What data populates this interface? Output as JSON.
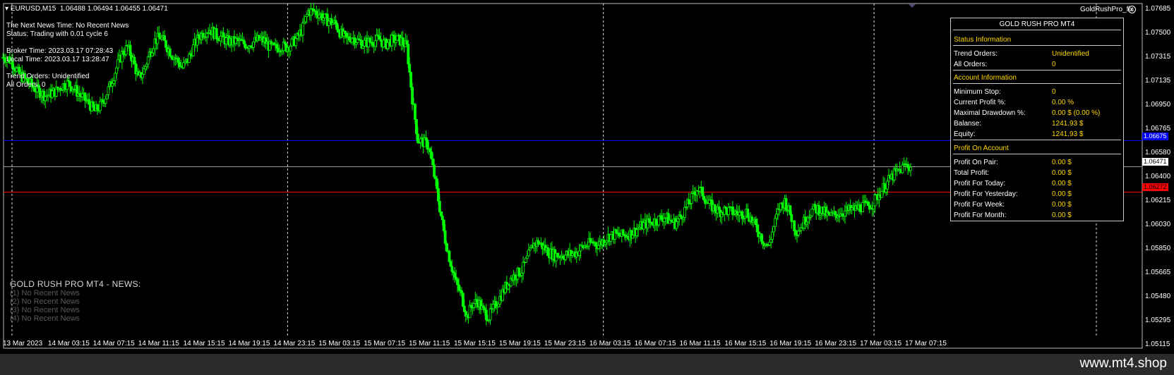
{
  "header": {
    "symbol": "EURUSD,M15",
    "ohlc": "1.06488 1.06494 1.06455 1.06471",
    "ea_name": "GoldRushPro_fix"
  },
  "info": {
    "news_time": "The Next News Time: No Recent News",
    "status": "Status: Trading with 0.01 cycle 6",
    "broker_time": "Broker Time: 2023.03.17 07:28:43",
    "local_time": "Local Time: 2023.03.17 13:28:47",
    "trend_orders": "Trend Orders: Unidentified",
    "all_orders": "All Orders: 0"
  },
  "news": {
    "title": "GOLD RUSH PRO MT4 - NEWS:",
    "items": [
      "(1)  No Recent News",
      "(2)  No Recent News",
      "(3)  No Recent News",
      "(4)  No Recent News"
    ]
  },
  "panel": {
    "title": "GOLD RUSH PRO MT4",
    "status_header": "Status Information",
    "account_header": "Account Information",
    "profit_header": "Profit On Account",
    "status_rows": [
      {
        "label": "Trend Orders:",
        "value": "Unidentified"
      },
      {
        "label": "All Orders:",
        "value": "0"
      }
    ],
    "account_rows": [
      {
        "label": "Minimum Stop:",
        "value": "0"
      },
      {
        "label": "Current Profit %:",
        "value": "0.00 %"
      },
      {
        "label": "Maximal Drawdown %:",
        "value": "0.00 $ (0.00 %)"
      },
      {
        "label": "Balanse:",
        "value": "1241.93 $"
      },
      {
        "label": "Equity:",
        "value": "1241.93 $"
      }
    ],
    "profit_rows": [
      {
        "label": "Profit On Pair:",
        "value": "0.00 $"
      },
      {
        "label": "Total Profit:",
        "value": "0.00 $"
      },
      {
        "label": "Profit For Today:",
        "value": "0.00 $"
      },
      {
        "label": "Profit For Yesterday:",
        "value": "0.00 $"
      },
      {
        "label": "Profit For Week:",
        "value": "0.00 $"
      },
      {
        "label": "Profit For Month:",
        "value": "0.00 $"
      }
    ]
  },
  "price_axis": [
    "1.07685",
    "1.07500",
    "1.07315",
    "1.07135",
    "1.06950",
    "1.06765",
    "1.06580",
    "1.06400",
    "1.06215",
    "1.06030",
    "1.05850",
    "1.05665",
    "1.05480",
    "1.05295",
    "1.05115"
  ],
  "price_tags": {
    "blue": "1.06675",
    "current": "1.06471",
    "red": "1.06272"
  },
  "time_axis": [
    "13 Mar 2023",
    "14 Mar 03:15",
    "14 Mar 07:15",
    "14 Mar 11:15",
    "14 Mar 15:15",
    "14 Mar 19:15",
    "14 Mar 23:15",
    "15 Mar 03:15",
    "15 Mar 07:15",
    "15 Mar 11:15",
    "15 Mar 15:15",
    "15 Mar 19:15",
    "15 Mar 23:15",
    "16 Mar 03:15",
    "16 Mar 07:15",
    "16 Mar 11:15",
    "16 Mar 15:15",
    "16 Mar 19:15",
    "16 Mar 23:15",
    "17 Mar 03:15",
    "17 Mar 07:15"
  ],
  "footer": "www.mt4.shop",
  "chart_data": {
    "type": "line",
    "series": [
      {
        "values": [
          1.0732,
          1.0728,
          1.072,
          1.0716,
          1.0712,
          1.0708,
          1.0705,
          1.0702,
          1.0704,
          1.0706,
          1.071,
          1.0712,
          1.0709,
          1.0704,
          1.07,
          1.0696,
          1.069,
          1.0694,
          1.0702,
          1.0712,
          1.0724,
          1.0735,
          1.074,
          1.073,
          1.0715,
          1.0722,
          1.0735,
          1.0745,
          1.0748,
          1.0742,
          1.0735,
          1.073,
          1.0724,
          1.073,
          1.074,
          1.0748,
          1.0752,
          1.0754,
          1.075,
          1.0748,
          1.0745,
          1.0744,
          1.0745,
          1.0743,
          1.0742,
          1.0744,
          1.0746,
          1.0745,
          1.074,
          1.0739,
          1.0741,
          1.074,
          1.0743,
          1.0747,
          1.0755,
          1.0768,
          1.0768,
          1.0766,
          1.0762,
          1.076,
          1.0758,
          1.075,
          1.0746,
          1.0748,
          1.0745,
          1.0743,
          1.0744,
          1.0745,
          1.0746,
          1.0742,
          1.0745,
          1.0746,
          1.0745,
          1.074,
          1.07,
          1.0668,
          1.0666,
          1.0663,
          1.064,
          1.0615,
          1.059,
          1.0572,
          1.0556,
          1.0546,
          1.053,
          1.054,
          1.0542,
          1.0534,
          1.053,
          1.0538,
          1.0545,
          1.0553,
          1.056,
          1.0563,
          1.0566,
          1.0575,
          1.0586,
          1.0588,
          1.0584,
          1.058,
          1.0578,
          1.0578,
          1.0578,
          1.0579,
          1.058,
          1.0584,
          1.0586,
          1.0588,
          1.0586,
          1.059,
          1.0593,
          1.0594,
          1.0593,
          1.0594,
          1.0595,
          1.0598,
          1.0601,
          1.0603,
          1.0604,
          1.0606,
          1.0608,
          1.0605,
          1.0603,
          1.0608,
          1.0615,
          1.0622,
          1.063,
          1.0626,
          1.0618,
          1.0615,
          1.0612,
          1.0613,
          1.0612,
          1.0611,
          1.061,
          1.0612,
          1.0605,
          1.0598,
          1.059,
          1.0584,
          1.06,
          1.0615,
          1.062,
          1.061,
          1.0597,
          1.06,
          1.0608,
          1.0613,
          1.0614,
          1.0612,
          1.0608,
          1.0609,
          1.0611,
          1.0612,
          1.0613,
          1.0614,
          1.0616,
          1.0616,
          1.0618,
          1.0624,
          1.063,
          1.0636,
          1.0641,
          1.0644,
          1.0648,
          1.0647
        ]
      }
    ],
    "ylim": [
      1.05115,
      1.07685
    ],
    "price_lines": [
      {
        "value": 1.06675,
        "color": "#0000ff"
      },
      {
        "value": 1.06471,
        "color": "#9a9a9a"
      },
      {
        "value": 1.06272,
        "color": "#ff0000"
      }
    ],
    "vertical_separators": [
      "14 Mar 23:15",
      "16 Mar 03:15",
      "17 Mar 03:15",
      "17 Mar 07:15"
    ],
    "grid": false,
    "colors": {
      "candle": "#00ff00",
      "background": "#000000"
    }
  }
}
